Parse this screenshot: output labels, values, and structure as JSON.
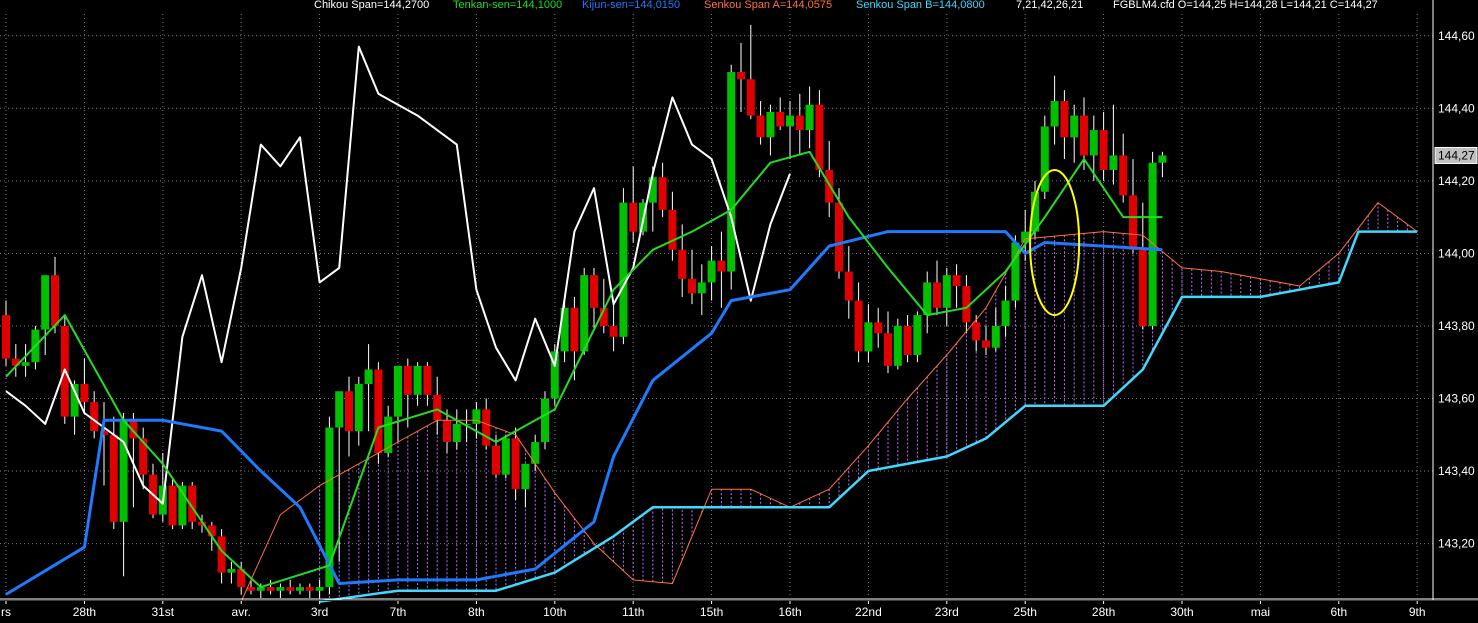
{
  "header": {
    "chikou": "Chikou Span=144,2700",
    "tenkan": "Tenkan-sen=144,1000",
    "kijun": "Kijun-sen=144,0150",
    "senkou_a": "Senkou Span A=144,0575",
    "senkou_b": "Senkou Span B=144,0800",
    "params": "7,21,42,26,21",
    "ohlc": "FGBLM4.cfd O=144,25 H=144,28 L=144,21 C=144,27"
  },
  "colors": {
    "background": "#000000",
    "up": "#00c000",
    "down": "#e00000",
    "chikou": "#ffffff",
    "tenkan": "#22dd22",
    "kijun": "#1e7bff",
    "senkou_a": "#ff7040",
    "senkou_b": "#40d8ff",
    "cloud": "#c070ff",
    "grid": "#808080",
    "highlight": "#ffff00"
  },
  "chart_data": {
    "type": "candlestick",
    "symbol": "FGBLM4.cfd",
    "ylim": [
      143.05,
      144.66
    ],
    "yticks": [
      143.2,
      143.4,
      143.6,
      143.8,
      144.0,
      144.2,
      144.4,
      144.6
    ],
    "ytick_labels": [
      "143,20",
      "143,40",
      "143,60",
      "143,80",
      "144,00",
      "144,20",
      "144,40",
      "144,60"
    ],
    "last_price_label": "144,27",
    "last_price": 144.27,
    "grid": true,
    "xlabels": [
      {
        "bar": 0,
        "label": "rs"
      },
      {
        "bar": 8,
        "label": "28th"
      },
      {
        "bar": 16,
        "label": "31st"
      },
      {
        "bar": 24,
        "label": "avr."
      },
      {
        "bar": 32,
        "label": "3rd"
      },
      {
        "bar": 40,
        "label": "7th"
      },
      {
        "bar": 48,
        "label": "8th"
      },
      {
        "bar": 56,
        "label": "10th"
      },
      {
        "bar": 64,
        "label": "11th"
      },
      {
        "bar": 72,
        "label": "15th"
      },
      {
        "bar": 80,
        "label": "16th"
      },
      {
        "bar": 88,
        "label": "22nd"
      },
      {
        "bar": 96,
        "label": "23rd"
      },
      {
        "bar": 104,
        "label": "25th"
      },
      {
        "bar": 112,
        "label": "28th"
      },
      {
        "bar": 120,
        "label": "30th"
      },
      {
        "bar": 128,
        "label": "mai"
      },
      {
        "bar": 136,
        "label": "6th"
      },
      {
        "bar": 144,
        "label": "9th"
      }
    ],
    "candles": [
      [
        143.83,
        143.87,
        143.69,
        143.71
      ],
      [
        143.71,
        143.75,
        143.66,
        143.69
      ],
      [
        143.69,
        143.75,
        143.66,
        143.7
      ],
      [
        143.7,
        143.8,
        143.68,
        143.79
      ],
      [
        143.79,
        143.9,
        143.72,
        143.94
      ],
      [
        143.94,
        143.99,
        143.78,
        143.8
      ],
      [
        143.8,
        143.83,
        143.53,
        143.55
      ],
      [
        143.55,
        143.65,
        143.5,
        143.64
      ],
      [
        143.64,
        143.71,
        143.56,
        143.59
      ],
      [
        143.59,
        143.62,
        143.49,
        143.51
      ],
      [
        143.51,
        143.59,
        143.36,
        143.5
      ],
      [
        143.5,
        143.55,
        143.24,
        143.26
      ],
      [
        143.26,
        143.56,
        143.11,
        143.54
      ],
      [
        143.54,
        143.56,
        143.3,
        143.49
      ],
      [
        143.49,
        143.52,
        143.35,
        143.39
      ],
      [
        143.39,
        143.42,
        143.27,
        143.28
      ],
      [
        143.28,
        143.45,
        143.26,
        143.36
      ],
      [
        143.36,
        143.38,
        143.24,
        143.25
      ],
      [
        143.25,
        143.37,
        143.24,
        143.36
      ],
      [
        143.36,
        143.37,
        143.24,
        143.26
      ],
      [
        143.26,
        143.28,
        143.23,
        143.25
      ],
      [
        143.25,
        143.26,
        143.18,
        143.22
      ],
      [
        143.22,
        143.24,
        143.09,
        143.12
      ],
      [
        143.12,
        143.15,
        143.09,
        143.13
      ],
      [
        143.13,
        143.15,
        143.06,
        143.08
      ],
      [
        143.08,
        143.1,
        143.06,
        143.07
      ],
      [
        143.07,
        143.09,
        143.05,
        143.08
      ],
      [
        143.08,
        143.1,
        143.06,
        143.07
      ],
      [
        143.07,
        143.09,
        143.05,
        143.08
      ],
      [
        143.08,
        143.1,
        143.06,
        143.07
      ],
      [
        143.07,
        143.09,
        143.06,
        143.08
      ],
      [
        143.08,
        143.09,
        143.05,
        143.07
      ],
      [
        143.07,
        143.1,
        143.05,
        143.08
      ],
      [
        143.08,
        143.55,
        143.06,
        143.52
      ],
      [
        143.52,
        143.6,
        143.15,
        143.62
      ],
      [
        143.62,
        143.66,
        143.44,
        143.51
      ],
      [
        143.51,
        143.66,
        143.47,
        143.64
      ],
      [
        143.64,
        143.75,
        143.51,
        143.68
      ],
      [
        143.68,
        143.7,
        143.42,
        143.45
      ],
      [
        143.45,
        143.58,
        143.44,
        143.55
      ],
      [
        143.55,
        143.69,
        143.48,
        143.69
      ],
      [
        143.69,
        143.71,
        143.52,
        143.61
      ],
      [
        143.61,
        143.7,
        143.58,
        143.69
      ],
      [
        143.69,
        143.7,
        143.58,
        143.61
      ],
      [
        143.61,
        143.66,
        143.5,
        143.54
      ],
      [
        143.54,
        143.57,
        143.45,
        143.48
      ],
      [
        143.48,
        143.57,
        143.46,
        143.53
      ],
      [
        143.53,
        143.57,
        143.48,
        143.53
      ],
      [
        143.53,
        143.59,
        143.49,
        143.57
      ],
      [
        143.57,
        143.6,
        143.46,
        143.47
      ],
      [
        143.47,
        143.5,
        143.38,
        143.39
      ],
      [
        143.39,
        143.5,
        143.38,
        143.49
      ],
      [
        143.49,
        143.52,
        143.32,
        143.35
      ],
      [
        143.35,
        143.42,
        143.3,
        143.42
      ],
      [
        143.42,
        143.5,
        143.4,
        143.48
      ],
      [
        143.48,
        143.62,
        143.46,
        143.6
      ],
      [
        143.6,
        143.75,
        143.58,
        143.73
      ],
      [
        143.73,
        143.87,
        143.7,
        143.85
      ],
      [
        143.85,
        143.88,
        143.65,
        143.73
      ],
      [
        143.73,
        143.96,
        143.72,
        143.94
      ],
      [
        143.94,
        143.96,
        143.79,
        143.85
      ],
      [
        143.85,
        143.93,
        143.78,
        143.8
      ],
      [
        143.8,
        143.86,
        143.73,
        143.77
      ],
      [
        143.77,
        144.18,
        143.75,
        144.14
      ],
      [
        144.14,
        144.24,
        144.03,
        144.06
      ],
      [
        144.06,
        144.15,
        144.05,
        144.14
      ],
      [
        144.14,
        144.24,
        144.06,
        144.21
      ],
      [
        144.21,
        144.25,
        144.1,
        144.12
      ],
      [
        144.12,
        144.17,
        143.98,
        144.01
      ],
      [
        144.01,
        144.08,
        143.88,
        143.93
      ],
      [
        143.93,
        144.01,
        143.86,
        143.89
      ],
      [
        143.89,
        143.97,
        143.83,
        143.92
      ],
      [
        143.92,
        144.02,
        143.87,
        143.98
      ],
      [
        143.98,
        144.06,
        143.85,
        143.95
      ],
      [
        143.95,
        144.52,
        143.9,
        144.5
      ],
      [
        144.5,
        144.58,
        144.39,
        144.48
      ],
      [
        144.48,
        144.63,
        144.37,
        144.38
      ],
      [
        144.38,
        144.42,
        144.3,
        144.32
      ],
      [
        144.32,
        144.41,
        144.27,
        144.39
      ],
      [
        144.39,
        144.43,
        144.34,
        144.35
      ],
      [
        144.35,
        144.42,
        144.26,
        144.38
      ],
      [
        144.38,
        144.44,
        144.27,
        144.34
      ],
      [
        144.34,
        144.46,
        144.29,
        144.41
      ],
      [
        144.41,
        144.45,
        144.21,
        144.23
      ],
      [
        144.23,
        144.31,
        144.1,
        144.14
      ],
      [
        144.14,
        144.18,
        143.93,
        143.95
      ],
      [
        143.95,
        144.02,
        143.82,
        143.87
      ],
      [
        143.87,
        143.92,
        143.7,
        143.73
      ],
      [
        143.73,
        143.86,
        143.7,
        143.81
      ],
      [
        143.81,
        143.85,
        143.74,
        143.78
      ],
      [
        143.78,
        143.84,
        143.67,
        143.69
      ],
      [
        143.69,
        143.82,
        143.68,
        143.8
      ],
      [
        143.8,
        143.83,
        143.7,
        143.72
      ],
      [
        143.72,
        143.84,
        143.7,
        143.83
      ],
      [
        143.83,
        143.95,
        143.78,
        143.92
      ],
      [
        143.92,
        143.98,
        143.83,
        143.85
      ],
      [
        143.85,
        143.96,
        143.8,
        143.94
      ],
      [
        143.94,
        143.97,
        143.85,
        143.91
      ],
      [
        143.91,
        143.94,
        143.78,
        143.81
      ],
      [
        143.81,
        143.83,
        143.73,
        143.76
      ],
      [
        143.76,
        143.8,
        143.72,
        143.74
      ],
      [
        143.74,
        143.85,
        143.73,
        143.8
      ],
      [
        143.8,
        143.91,
        143.77,
        143.87
      ],
      [
        143.87,
        144.05,
        143.85,
        144.03
      ],
      [
        144.03,
        144.12,
        143.98,
        144.06
      ],
      [
        144.06,
        144.2,
        144.04,
        144.17
      ],
      [
        144.17,
        144.38,
        144.15,
        144.35
      ],
      [
        144.35,
        144.49,
        144.3,
        144.42
      ],
      [
        144.42,
        144.45,
        144.26,
        144.32
      ],
      [
        144.32,
        144.41,
        144.25,
        144.38
      ],
      [
        144.38,
        144.43,
        144.23,
        144.27
      ],
      [
        144.27,
        144.38,
        144.2,
        144.34
      ],
      [
        144.34,
        144.39,
        144.2,
        144.23
      ],
      [
        144.23,
        144.41,
        144.19,
        144.27
      ],
      [
        144.27,
        144.33,
        144.14,
        144.16
      ],
      [
        144.16,
        144.26,
        144.0,
        144.01
      ],
      [
        144.01,
        144.14,
        143.79,
        143.8
      ],
      [
        143.8,
        144.28,
        143.79,
        144.25
      ],
      [
        144.25,
        144.28,
        144.21,
        144.27
      ]
    ],
    "tenkan_sen": [
      [
        0,
        143.66
      ],
      [
        6,
        143.83
      ],
      [
        12,
        143.54
      ],
      [
        16,
        143.42
      ],
      [
        22,
        143.18
      ],
      [
        26,
        143.08
      ],
      [
        33,
        143.14
      ],
      [
        38,
        143.52
      ],
      [
        44,
        143.57
      ],
      [
        50,
        143.48
      ],
      [
        56,
        143.57
      ],
      [
        62,
        143.9
      ],
      [
        66,
        144.01
      ],
      [
        70,
        144.06
      ],
      [
        74,
        144.12
      ],
      [
        78,
        144.25
      ],
      [
        82,
        144.28
      ],
      [
        86,
        144.1
      ],
      [
        90,
        143.96
      ],
      [
        94,
        143.83
      ],
      [
        98,
        143.85
      ],
      [
        102,
        143.95
      ],
      [
        106,
        144.1
      ],
      [
        110,
        144.26
      ],
      [
        114,
        144.1
      ],
      [
        118,
        144.1
      ]
    ],
    "kijun_sen": [
      [
        0,
        143.06
      ],
      [
        8,
        143.19
      ],
      [
        10,
        143.54
      ],
      [
        16,
        143.54
      ],
      [
        22,
        143.51
      ],
      [
        26,
        143.4
      ],
      [
        30,
        143.3
      ],
      [
        34,
        143.09
      ],
      [
        40,
        143.1
      ],
      [
        48,
        143.1
      ],
      [
        54,
        143.13
      ],
      [
        60,
        143.26
      ],
      [
        62,
        143.44
      ],
      [
        66,
        143.65
      ],
      [
        72,
        143.78
      ],
      [
        74,
        143.87
      ],
      [
        80,
        143.9
      ],
      [
        84,
        144.02
      ],
      [
        90,
        144.06
      ],
      [
        98,
        144.06
      ],
      [
        102,
        144.06
      ],
      [
        104,
        144.0
      ],
      [
        106,
        144.03
      ],
      [
        118,
        144.01
      ]
    ],
    "senkou_span_a": [
      [
        24,
        143.04
      ],
      [
        28,
        143.28
      ],
      [
        32,
        143.36
      ],
      [
        36,
        143.42
      ],
      [
        40,
        143.48
      ],
      [
        44,
        143.54
      ],
      [
        48,
        143.54
      ],
      [
        52,
        143.5
      ],
      [
        56,
        143.34
      ],
      [
        60,
        143.2
      ],
      [
        64,
        143.1
      ],
      [
        68,
        143.09
      ],
      [
        72,
        143.35
      ],
      [
        76,
        143.35
      ],
      [
        80,
        143.3
      ],
      [
        84,
        143.35
      ],
      [
        88,
        143.47
      ],
      [
        92,
        143.6
      ],
      [
        96,
        143.72
      ],
      [
        100,
        143.85
      ],
      [
        104,
        144.04
      ],
      [
        108,
        144.05
      ],
      [
        112,
        144.06
      ],
      [
        116,
        144.05
      ],
      [
        120,
        143.96
      ],
      [
        124,
        143.95
      ],
      [
        128,
        143.93
      ],
      [
        132,
        143.91
      ],
      [
        136,
        144.0
      ],
      [
        140,
        144.14
      ],
      [
        144,
        144.06
      ]
    ],
    "senkou_span_b": [
      [
        32,
        143.04
      ],
      [
        40,
        143.07
      ],
      [
        50,
        143.07
      ],
      [
        56,
        143.12
      ],
      [
        62,
        143.22
      ],
      [
        66,
        143.3
      ],
      [
        74,
        143.3
      ],
      [
        84,
        143.3
      ],
      [
        88,
        143.4
      ],
      [
        96,
        143.44
      ],
      [
        100,
        143.49
      ],
      [
        104,
        143.58
      ],
      [
        112,
        143.58
      ],
      [
        116,
        143.68
      ],
      [
        120,
        143.88
      ],
      [
        128,
        143.88
      ],
      [
        136,
        143.92
      ],
      [
        138,
        144.06
      ],
      [
        144,
        144.06
      ]
    ],
    "chikou_span": [
      [
        0,
        143.62
      ],
      [
        2,
        143.58
      ],
      [
        4,
        143.53
      ],
      [
        6,
        143.68
      ],
      [
        8,
        143.56
      ],
      [
        10,
        143.52
      ],
      [
        12,
        143.48
      ],
      [
        14,
        143.36
      ],
      [
        16,
        143.31
      ],
      [
        18,
        143.77
      ],
      [
        20,
        143.94
      ],
      [
        22,
        143.7
      ],
      [
        24,
        143.96
      ],
      [
        26,
        144.3
      ],
      [
        28,
        144.24
      ],
      [
        30,
        144.32
      ],
      [
        32,
        143.92
      ],
      [
        34,
        143.96
      ],
      [
        36,
        144.57
      ],
      [
        38,
        144.44
      ],
      [
        42,
        144.38
      ],
      [
        46,
        144.3
      ],
      [
        48,
        143.9
      ],
      [
        50,
        143.74
      ],
      [
        52,
        143.65
      ],
      [
        54,
        143.82
      ],
      [
        56,
        143.69
      ],
      [
        58,
        144.06
      ],
      [
        60,
        144.18
      ],
      [
        62,
        143.86
      ],
      [
        64,
        143.96
      ],
      [
        66,
        144.22
      ],
      [
        68,
        144.43
      ],
      [
        70,
        144.3
      ],
      [
        72,
        144.26
      ],
      [
        74,
        144.1
      ],
      [
        76,
        143.87
      ],
      [
        78,
        144.08
      ],
      [
        80,
        144.22
      ]
    ],
    "annotation": {
      "type": "ellipse",
      "center_bar": 107,
      "center_y": 144.03,
      "rx_bars": 2.3,
      "ry_price": 0.1
    }
  }
}
